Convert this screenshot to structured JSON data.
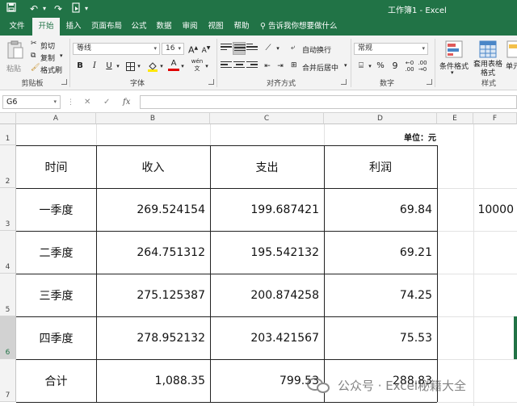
{
  "window": {
    "title": "工作簿1 - Excel"
  },
  "tabs": [
    "文件",
    "开始",
    "插入",
    "页面布局",
    "公式",
    "数据",
    "审阅",
    "视图",
    "帮助"
  ],
  "tell_me": "告诉我你想要做什么",
  "ribbon": {
    "clipboard": {
      "paste": "粘贴",
      "cut": "剪切",
      "copy": "复制",
      "format_painter": "格式刷",
      "label": "剪贴板"
    },
    "font": {
      "name": "等线",
      "size": "16",
      "bold": "B",
      "italic": "I",
      "underline": "U",
      "grow": "A",
      "shrink": "A",
      "label": "字体"
    },
    "alignment": {
      "wrap": "自动换行",
      "merge": "合并后居中",
      "label": "对齐方式"
    },
    "number": {
      "format": "常规",
      "percent": "%",
      "comma": "9",
      "label": "数字"
    },
    "styles": {
      "conditional": "条件格式",
      "table": "套用表格格式",
      "cell": "单元",
      "label": "样式"
    }
  },
  "formula_bar": {
    "name_box": "G6",
    "fx": "fx",
    "formula": ""
  },
  "sheet": {
    "columns": [
      "A",
      "B",
      "C",
      "D",
      "E",
      "F"
    ],
    "rows": [
      "1",
      "2",
      "3",
      "4",
      "5",
      "6",
      "7"
    ],
    "unit_label": "单位：元",
    "header": [
      "时间",
      "收入",
      "支出",
      "利润"
    ],
    "data": [
      [
        "一季度",
        "269.524154",
        "199.687421",
        "69.84"
      ],
      [
        "二季度",
        "264.751312",
        "195.542132",
        "69.21"
      ],
      [
        "三季度",
        "275.125387",
        "200.874258",
        "74.25"
      ],
      [
        "四季度",
        "278.952132",
        "203.421567",
        "75.53"
      ]
    ],
    "total": [
      "合计",
      "1,088.35",
      "799.53",
      "288.83"
    ],
    "f3": "10000"
  },
  "watermark": "公众号 · Excel秘籍大全",
  "colors": {
    "excel_green": "#217346",
    "ribbon_bg": "#f3f3f3"
  }
}
